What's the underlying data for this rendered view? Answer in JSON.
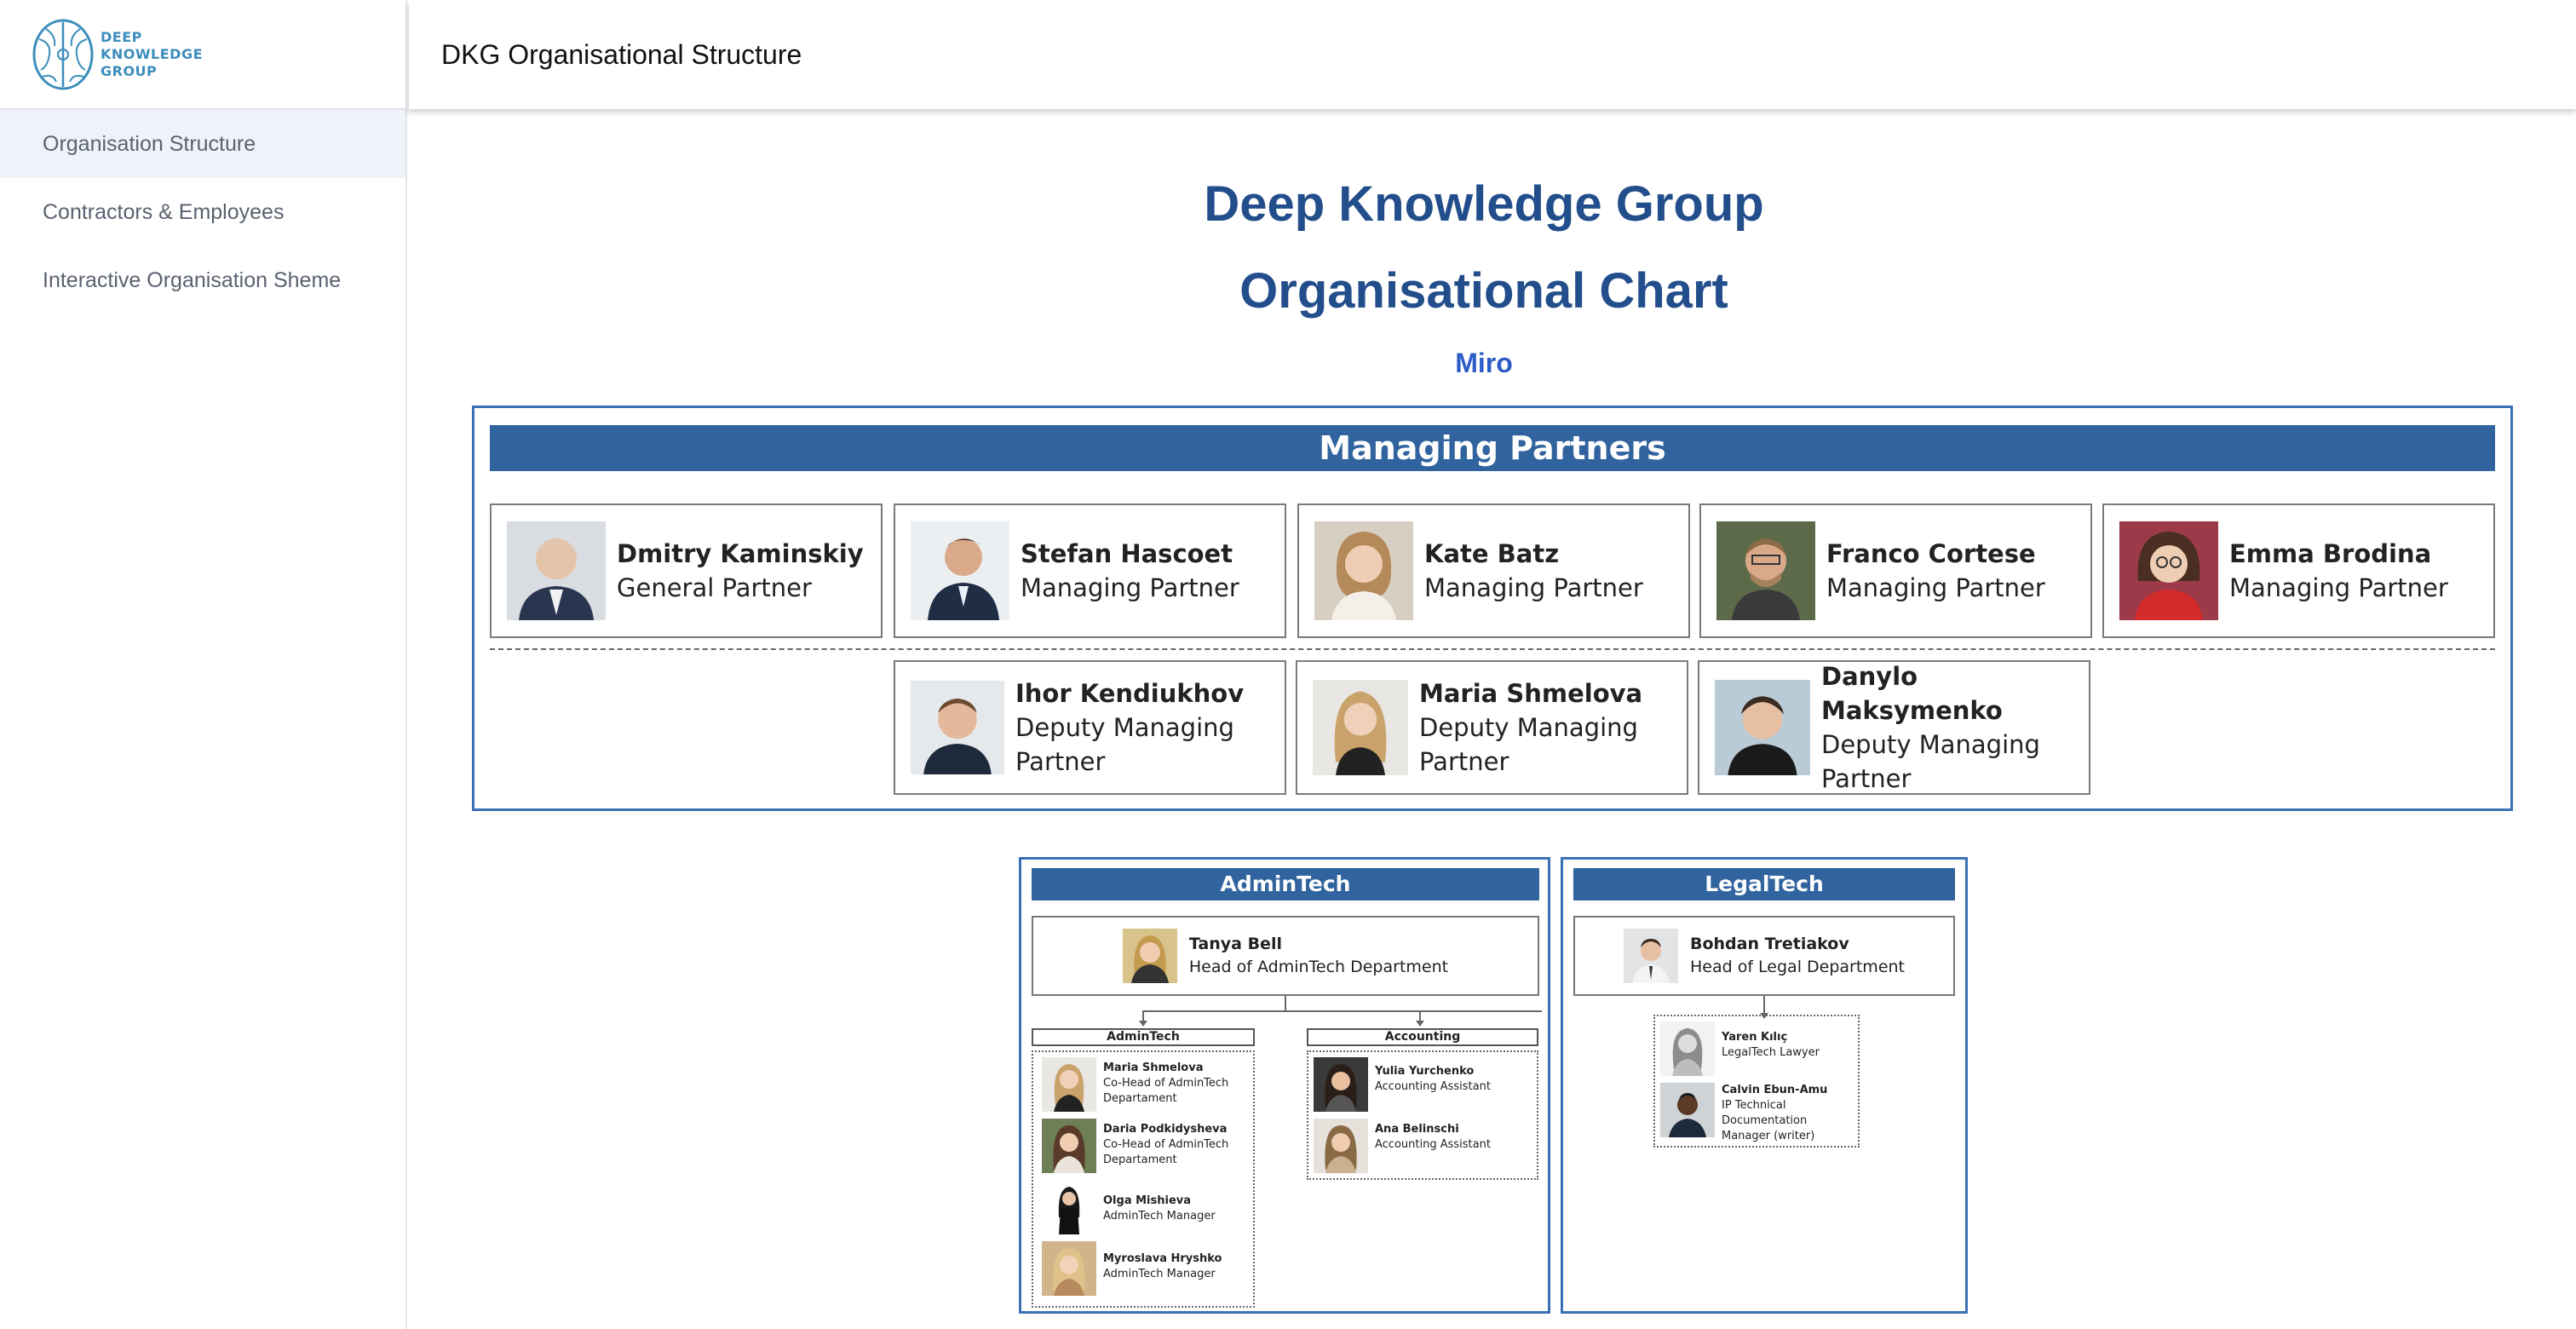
{
  "brand": {
    "line1": "DEEP",
    "line2": "KNOWLEDGE",
    "line3": "GROUP"
  },
  "sidebar": {
    "items": [
      {
        "label": "Organisation Structure",
        "active": true
      },
      {
        "label": "Contractors & Employees",
        "active": false
      },
      {
        "label": "Interactive Organisation Sheme",
        "active": false
      }
    ]
  },
  "header": {
    "title": "DKG Organisational Structure"
  },
  "document": {
    "title_line1": "Deep Knowledge Group",
    "title_line2": "Organisational Chart",
    "miro_link": "Miro"
  },
  "managing_partners": {
    "banner": "Managing Partners",
    "partners": [
      {
        "name": "Dmitry Kaminskiy",
        "role": "General Partner"
      },
      {
        "name": "Stefan Hascoet",
        "role": "Managing Partner"
      },
      {
        "name": "Kate Batz",
        "role": "Managing Partner"
      },
      {
        "name": "Franco Cortese",
        "role": "Managing Partner"
      },
      {
        "name": "Emma Brodina",
        "role": "Managing Partner"
      }
    ],
    "deputies": [
      {
        "name": "Ihor Kendiukhov",
        "role": "Deputy Managing Partner"
      },
      {
        "name": "Maria Shmelova",
        "role": "Deputy Managing Partner"
      },
      {
        "name": "Danylo Maksymenko",
        "role": "Deputy Managing Partner"
      }
    ]
  },
  "admintech": {
    "banner": "AdminTech",
    "head": {
      "name": "Tanya Bell",
      "role": "Head of AdminTech Department"
    },
    "teams": [
      {
        "label": "AdminTech",
        "members": [
          {
            "name": "Maria Shmelova",
            "role": "Co-Head of AdminTech Departament"
          },
          {
            "name": "Daria Podkidysheva",
            "role": "Co-Head of AdminTech Departament"
          },
          {
            "name": "Olga Mishieva",
            "role": "AdminTech Manager"
          },
          {
            "name": "Myroslava Hryshko",
            "role": "AdminTech Manager"
          }
        ]
      },
      {
        "label": "Accounting",
        "members": [
          {
            "name": "Yulia Yurchenko",
            "role": "Accounting Assistant"
          },
          {
            "name": "Ana Belinschi",
            "role": "Accounting Assistant"
          }
        ]
      }
    ]
  },
  "legaltech": {
    "banner": "LegalTech",
    "head": {
      "name": "Bohdan Tretiakov",
      "role": "Head of Legal Department"
    },
    "members": [
      {
        "name": "Yaren Kılıç",
        "role": "LegalTech Lawyer"
      },
      {
        "name": "Calvin Ebun-Amu",
        "role": "IP Technical Documentation Manager (writer)"
      }
    ]
  },
  "colors": {
    "accent": "#234e8c",
    "banner": "#31649f",
    "frame": "#3b6fb6",
    "link": "#2c5cc5",
    "active_nav": "#eef3fa"
  }
}
